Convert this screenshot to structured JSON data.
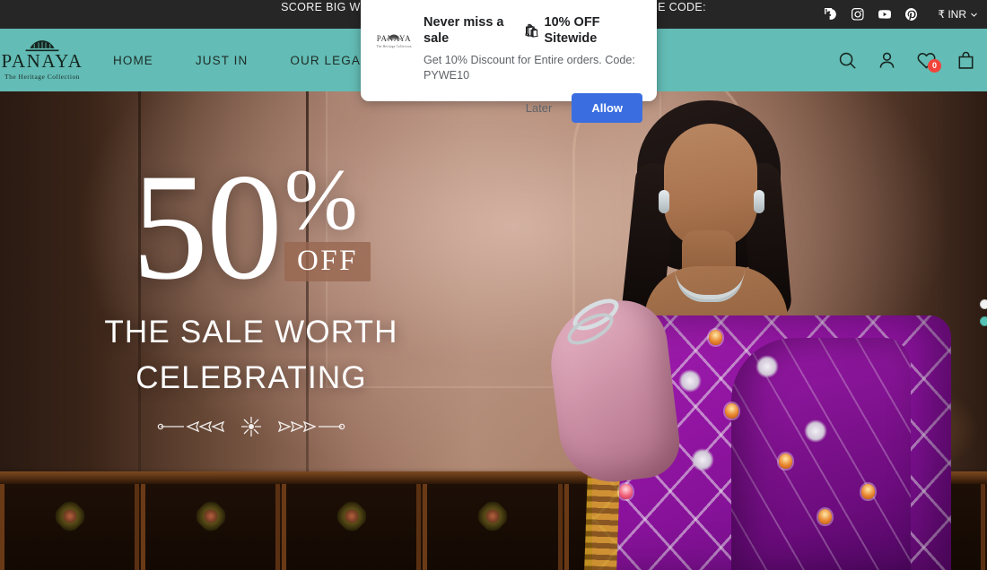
{
  "announcement": {
    "text": "SCORE BIG WITH 50% OFF! | WELCOME OFFER 10% HURRY!!! | USE CODE:",
    "social": [
      {
        "name": "facebook-icon",
        "label": "Facebook"
      },
      {
        "name": "instagram-icon",
        "label": "Instagram"
      },
      {
        "name": "youtube-icon",
        "label": "YouTube"
      },
      {
        "name": "pinterest-icon",
        "label": "Pinterest"
      }
    ],
    "currency": "₹ INR",
    "currency_chevron": "chevron-down-icon"
  },
  "header": {
    "logo": {
      "name": "PANAYA",
      "tagline": "The Heritage Collection",
      "ornament": "crown-arch-icon"
    },
    "nav": [
      {
        "label": "HOME"
      },
      {
        "label": "JUST IN"
      },
      {
        "label": "OUR LEGACY"
      }
    ],
    "actions": {
      "search": "search-icon",
      "account": "user-icon",
      "wishlist": "heart-icon",
      "wishlist_count": "0",
      "bag": "shopping-bag-icon"
    },
    "background_color": "#63bcb5"
  },
  "hero": {
    "percent_number": "50",
    "percent_symbol": "%",
    "off_label": "OFF",
    "line1": "THE SALE WORTH",
    "line2": "CELEBRATING",
    "divider_icon": "floral-divider-icon",
    "off_badge_color": "#976750"
  },
  "carousel": {
    "dots": [
      {
        "active": false
      },
      {
        "active": true
      }
    ]
  },
  "notification": {
    "title_text": "Never miss a sale",
    "title_emoji": "🛍",
    "title_tail": "10% OFF Sitewide",
    "subtitle": "Get 10% Discount for Entire orders. Code: PYWE10",
    "logo_name": "PANAYA",
    "logo_tagline": "The Heritage Collection",
    "later_label": "Later",
    "allow_label": "Allow",
    "allow_color": "#3a6ee0"
  }
}
